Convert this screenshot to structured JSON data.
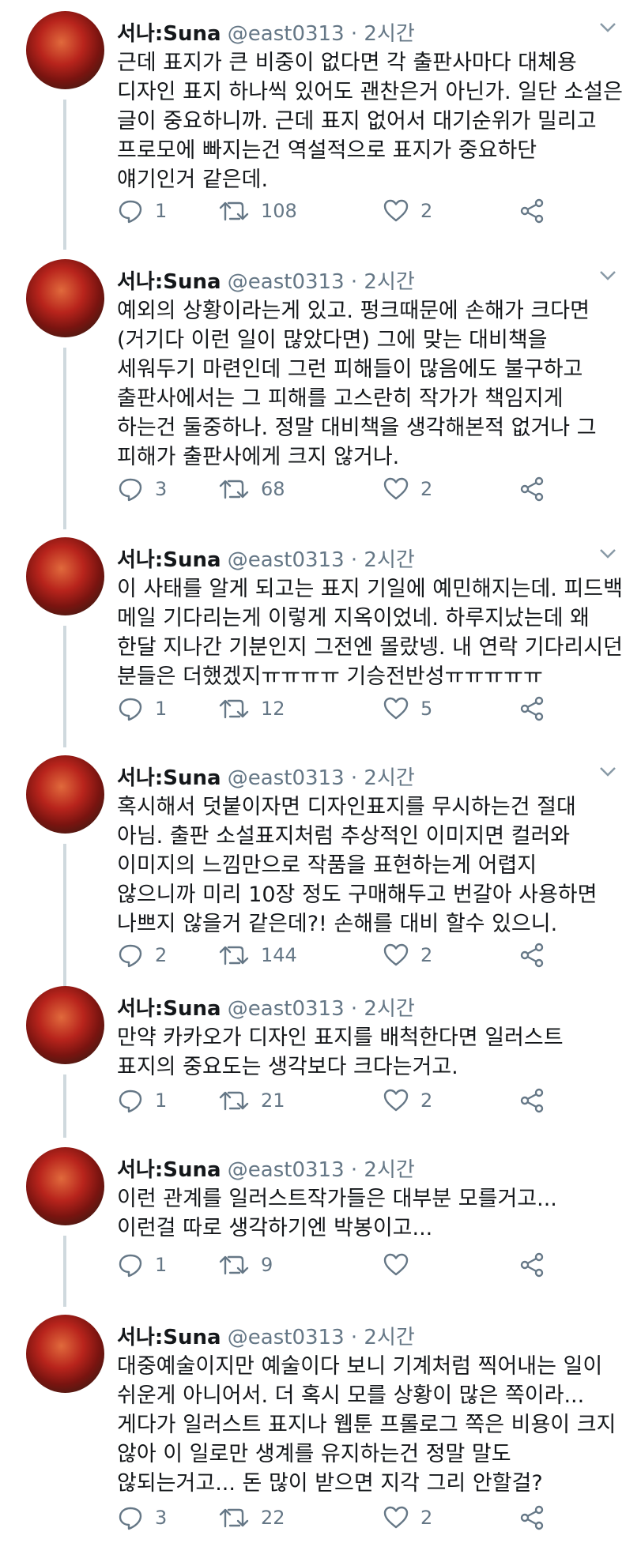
{
  "tweets": [
    {
      "name": "서나:Suna",
      "handle": "@east0313",
      "time": "· 2시간",
      "lines": [
        "근데 표지가 큰 비중이 없다면 각 출판사마다 대체용",
        "디자인 표지 하나씩 있어도 괜찬은거 아닌가. 일단 소설은",
        "글이 중요하니까. 근데 표지 없어서 대기순위가 밀리고",
        "프로모에 빠지는건 역설적으로 표지가 중요하단",
        "얘기인거 같은데."
      ],
      "reply": "1",
      "retweet": "108",
      "like": "2"
    },
    {
      "name": "서나:Suna",
      "handle": "@east0313",
      "time": "· 2시간",
      "lines": [
        "예외의 상황이라는게 있고. 펑크때문에 손해가 크다면",
        "(거기다 이런 일이 많았다면) 그에 맞는 대비책을",
        "세워두기 마련인데 그런 피해들이 많음에도 불구하고",
        "출판사에서는 그 피해를 고스란히 작가가 책임지게",
        "하는건 둘중하나. 정말 대비책을 생각해본적 없거나 그",
        "피해가 출판사에게 크지 않거나."
      ],
      "reply": "3",
      "retweet": "68",
      "like": "2"
    },
    {
      "name": "서나:Suna",
      "handle": "@east0313",
      "time": "· 2시간",
      "lines": [
        "이 사태를 알게 되고는 표지 기일에 예민해지는데. 피드백",
        "메일 기다리는게 이렇게 지옥이었네. 하루지났는데 왜",
        "한달 지나간 기분인지 그전엔 몰랐넹. 내 연락 기다리시던",
        "분들은 더했겠지ㅠㅠㅠㅠ 기승전반성ㅠㅠㅠㅠㅠ"
      ],
      "reply": "1",
      "retweet": "12",
      "like": "5"
    },
    {
      "name": "서나:Suna",
      "handle": "@east0313",
      "time": "· 2시간",
      "lines": [
        "혹시해서 덧붙이자면 디자인표지를 무시하는건 절대",
        "아님. 출판 소설표지처럼 추상적인 이미지면 컬러와",
        "이미지의 느낌만으로 작품을 표현하는게 어렵지",
        "않으니까 미리 10장 정도 구매해두고 번갈아 사용하면",
        "나쁘지 않을거 같은데?! 손해를 대비 할수 있으니."
      ],
      "reply": "2",
      "retweet": "144",
      "like": "2"
    },
    {
      "name": "서나:Suna",
      "handle": "@east0313",
      "time": "· 2시간",
      "lines": [
        "만약 카카오가 디자인 표지를 배척한다면 일러스트",
        "표지의 중요도는 생각보다 크다는거고."
      ],
      "reply": "1",
      "retweet": "21",
      "like": "2"
    },
    {
      "name": "서나:Suna",
      "handle": "@east0313",
      "time": "· 2시간",
      "lines": [
        "이런 관계를 일러스트작가들은 대부분 모를거고...",
        "이런걸 따로 생각하기엔 박봉이고..."
      ],
      "reply": "1",
      "retweet": "9",
      "like": ""
    },
    {
      "name": "서나:Suna",
      "handle": "@east0313",
      "time": "· 2시간",
      "lines": [
        "대중예술이지만 예술이다 보니 기계처럼 찍어내는 일이",
        "쉬운게 아니어서. 더 혹시 모를 상황이 많은 쪽이라...",
        "게다가 일러스트 표지나 웹툰 프롤로그 쪽은 비용이 크지",
        "않아 이 일로만 생계를 유지하는건 정말 말도",
        "않되는거고... 돈 많이 받으면 지각 그리 안할걸?"
      ],
      "reply": "3",
      "retweet": "22",
      "like": "2"
    }
  ]
}
